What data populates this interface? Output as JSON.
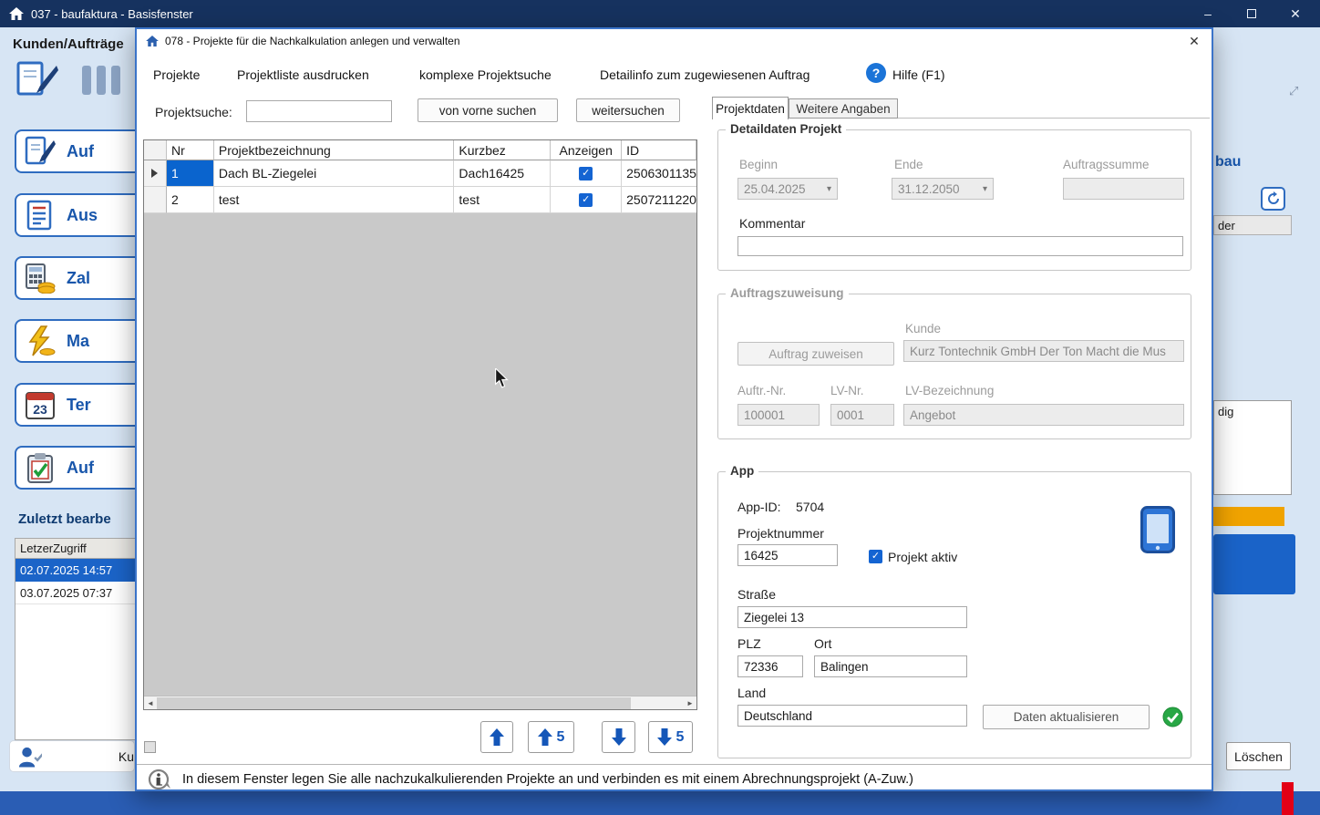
{
  "icons": {
    "minimize": "–",
    "close": "✕",
    "help": "?",
    "combo_arrow": "▾",
    "check": "✓",
    "scroll_left": "◄",
    "scroll_right": "►",
    "expand": "⤢"
  },
  "main_window": {
    "titlebar": {
      "title": "037  -  baufaktura - Basisfenster"
    },
    "sidebar": {
      "heading": "Kunden/Aufträge",
      "nav_buttons": [
        {
          "label": "Auf"
        },
        {
          "label": "Aus"
        },
        {
          "label": "Zal"
        },
        {
          "label": "Ma"
        },
        {
          "label": "Ter"
        },
        {
          "label": "Auf"
        }
      ],
      "recent_heading": "Zuletzt bearbe",
      "recent_column": "LetzerZugriff",
      "recent_rows": [
        {
          "value": "02.07.2025 14:57"
        },
        {
          "value": "03.07.2025 07:37"
        }
      ],
      "bottom_label": "Ku"
    },
    "right_panel": {
      "fragment_bau": "bau",
      "fragment_der": "der",
      "fragment_dig": "dig",
      "delete_button": "Löschen"
    }
  },
  "dialog": {
    "titlebar": {
      "title": "078 -  Projekte für die Nachkalkulation anlegen und verwalten"
    },
    "menu": {
      "items": [
        {
          "label": "Projekte"
        },
        {
          "label": "Projektliste ausdrucken"
        },
        {
          "label": "komplexe Projektsuche"
        },
        {
          "label": "Detailinfo zum zugewiesenen Auftrag"
        }
      ],
      "help_label": "Hilfe (F1)"
    },
    "search": {
      "label": "Projektsuche:",
      "value": "",
      "search_from_start": "von vorne suchen",
      "search_next": "weitersuchen"
    },
    "grid": {
      "columns": {
        "nr": "Nr",
        "name": "Projektbezeichnung",
        "short": "Kurzbez",
        "show": "Anzeigen",
        "id": "ID"
      },
      "rows": [
        {
          "nr": "1",
          "name": "Dach BL-Ziegelei",
          "short": "Dach16425",
          "anzeigen": true,
          "id": "2506301135"
        },
        {
          "nr": "2",
          "name": "test",
          "short": "test",
          "anzeigen": true,
          "id": "2507211220"
        }
      ]
    },
    "nav": {
      "step5": "5"
    },
    "tabs": {
      "active": "Projektdaten",
      "inactive": "Weitere Angaben"
    },
    "project_details": {
      "title": "Detaildaten Projekt",
      "begin_label": "Beginn",
      "begin_value": "25.04.2025",
      "end_label": "Ende",
      "end_value": "31.12.2050",
      "order_sum_label": "Auftragssumme",
      "order_sum_value": "",
      "comment_label": "Kommentar",
      "comment_value": ""
    },
    "order_assignment": {
      "title": "Auftragszuweisung",
      "assign_button": "Auftrag zuweisen",
      "customer_label": "Kunde",
      "customer_value": "Kurz Tontechnik GmbH Der Ton Macht die Mus",
      "order_no_label": "Auftr.-Nr.",
      "order_no_value": "100001",
      "lv_no_label": "LV-Nr.",
      "lv_no_value": "0001",
      "lv_name_label": "LV-Bezeichnung",
      "lv_name_value": "Angebot"
    },
    "app": {
      "title": "App",
      "app_id_label": "App-ID:",
      "app_id_value": "5704",
      "project_no_label": "Projektnummer",
      "project_no_value": "16425",
      "active_label": "Projekt aktiv",
      "street_label": "Straße",
      "street_value": "Ziegelei 13",
      "plz_label": "PLZ",
      "plz_value": "72336",
      "city_label": "Ort",
      "city_value": "Balingen",
      "country_label": "Land",
      "country_value": "Deutschland",
      "update_button": "Daten aktualisieren"
    },
    "status_text": "In diesem Fenster legen Sie alle nachzukalkulierenden Projekte an und verbinden es mit einem Abrechnungsprojekt (A-Zuw.)"
  }
}
